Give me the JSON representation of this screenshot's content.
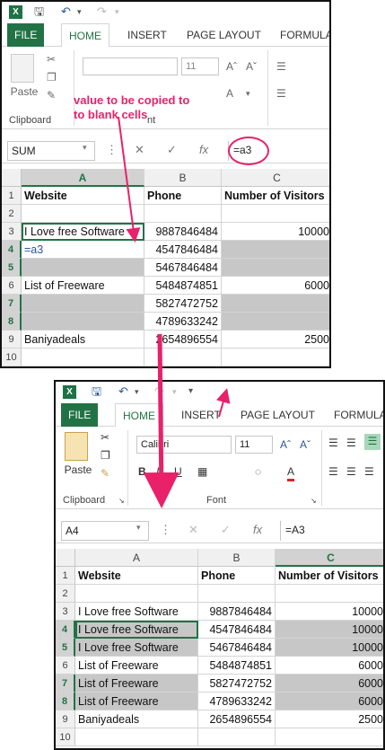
{
  "tabs": [
    "FILE",
    "HOME",
    "INSERT",
    "PAGE LAYOUT",
    "FORMULAS"
  ],
  "ribbon": {
    "paste_label": "Paste",
    "clipboard_label": "Clipboard",
    "font_label": "Font",
    "font_name": "Calibri",
    "font_size": "11",
    "text_fragment": "nt"
  },
  "annotation": {
    "text_line1": "value to be copied to",
    "text_line2": "to blank cells"
  },
  "top_sheet": {
    "name_box": "SUM",
    "formula": "=a3",
    "column_headers": [
      "A",
      "B",
      "C"
    ],
    "rows": [
      {
        "num": "1",
        "a": "Website",
        "b": "Phone",
        "c": "Number of Visitors"
      },
      {
        "num": "2",
        "a": "",
        "b": "",
        "c": ""
      },
      {
        "num": "3",
        "a": "I Love free Software",
        "b": "9887846484",
        "c": "10000"
      },
      {
        "num": "4",
        "a": "=a3",
        "b": "4547846484",
        "c": ""
      },
      {
        "num": "5",
        "a": "",
        "b": "5467846484",
        "c": ""
      },
      {
        "num": "6",
        "a": "List of Freeware",
        "b": "5484874851",
        "c": "6000"
      },
      {
        "num": "7",
        "a": "",
        "b": "5827472752",
        "c": ""
      },
      {
        "num": "8",
        "a": "",
        "b": "4789633242",
        "c": ""
      },
      {
        "num": "9",
        "a": "Baniyadeals",
        "b": "2654896554",
        "c": "2500"
      },
      {
        "num": "10",
        "a": "",
        "b": "",
        "c": ""
      }
    ]
  },
  "bottom_sheet": {
    "name_box": "A4",
    "formula": "=A3",
    "column_headers": [
      "A",
      "B",
      "C"
    ],
    "rows": [
      {
        "num": "1",
        "a": "Website",
        "b": "Phone",
        "c": "Number of Visitors"
      },
      {
        "num": "2",
        "a": "",
        "b": "",
        "c": ""
      },
      {
        "num": "3",
        "a": "I Love free Software",
        "b": "9887846484",
        "c": "10000"
      },
      {
        "num": "4",
        "a": "I Love free Software",
        "b": "4547846484",
        "c": "10000"
      },
      {
        "num": "5",
        "a": "I Love free Software",
        "b": "5467846484",
        "c": "10000"
      },
      {
        "num": "6",
        "a": "List of Freeware",
        "b": "5484874851",
        "c": "6000"
      },
      {
        "num": "7",
        "a": "List of Freeware",
        "b": "5827472752",
        "c": "6000"
      },
      {
        "num": "8",
        "a": "List of Freeware",
        "b": "4789633242",
        "c": "6000"
      },
      {
        "num": "9",
        "a": "Baniyadeals",
        "b": "2654896554",
        "c": "2500"
      },
      {
        "num": "10",
        "a": "",
        "b": "",
        "c": ""
      }
    ]
  },
  "colors": {
    "accent": "#217346",
    "annotation": "#e8216a",
    "selection": "#c7c7c7"
  }
}
